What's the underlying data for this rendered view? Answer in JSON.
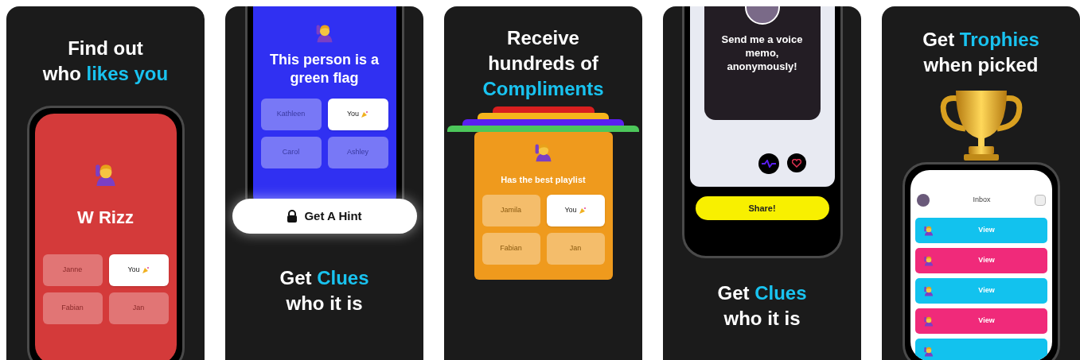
{
  "panels": [
    {
      "kind": "poll",
      "caption": [
        [
          {
            "text": "Find out",
            "highlight": false
          }
        ],
        [
          {
            "text": "who ",
            "highlight": false
          },
          {
            "text": "likes you",
            "highlight": true
          }
        ]
      ],
      "color": "#d43a3a",
      "question": "W Rizz",
      "options": [
        {
          "name": "Janne",
          "selected": false
        },
        {
          "name": "You",
          "selected": true
        },
        {
          "name": "Fabian",
          "selected": false
        },
        {
          "name": "Jan",
          "selected": false
        }
      ]
    },
    {
      "kind": "hint",
      "color": "#3030f2",
      "question": "This person is a green flag",
      "options": [
        {
          "name": "Kathleen",
          "selected": false
        },
        {
          "name": "You",
          "selected": true
        },
        {
          "name": "Carol",
          "selected": false
        },
        {
          "name": "Ashley",
          "selected": false
        }
      ],
      "button": "Get A Hint",
      "caption": [
        [
          {
            "text": "Get ",
            "highlight": false
          },
          {
            "text": "Clues",
            "highlight": true
          }
        ],
        [
          {
            "text": "who it is",
            "highlight": false
          }
        ]
      ]
    },
    {
      "kind": "compliments",
      "caption": [
        [
          {
            "text": "Receive",
            "highlight": false
          }
        ],
        [
          {
            "text": "hundreds of",
            "highlight": false
          }
        ],
        [
          {
            "text": "Compliments",
            "highlight": true
          }
        ]
      ],
      "stack": [
        {
          "color": "#d81f1f"
        },
        {
          "color": "#f6b51c"
        },
        {
          "color": "#5a1ff0"
        },
        {
          "color": "#4cc75a"
        }
      ],
      "color": "#ef9a1d",
      "question": "Has the best playlist",
      "options": [
        {
          "name": "Jamila",
          "selected": false
        },
        {
          "name": "You",
          "selected": true
        },
        {
          "name": "Fabian",
          "selected": false
        },
        {
          "name": "Jan",
          "selected": false
        }
      ]
    },
    {
      "kind": "voice",
      "prompt": "Send me a voice memo, anonymously!",
      "button": "Share!",
      "caption": [
        [
          {
            "text": "Get ",
            "highlight": false
          },
          {
            "text": "Clues",
            "highlight": true
          }
        ],
        [
          {
            "text": "who it is",
            "highlight": false
          }
        ]
      ]
    },
    {
      "kind": "trophies",
      "caption": [
        [
          {
            "text": "Get ",
            "highlight": false
          },
          {
            "text": "Trophies",
            "highlight": true
          }
        ],
        [
          {
            "text": "when picked",
            "highlight": false
          }
        ]
      ],
      "title": "Inbox",
      "rows": [
        {
          "label": "View",
          "color": "#12c2ee"
        },
        {
          "label": "View",
          "color": "#f02a7a"
        },
        {
          "label": "View",
          "color": "#12c2ee"
        },
        {
          "label": "View",
          "color": "#f02a7a"
        },
        {
          "color": "#12c2ee"
        }
      ]
    }
  ]
}
